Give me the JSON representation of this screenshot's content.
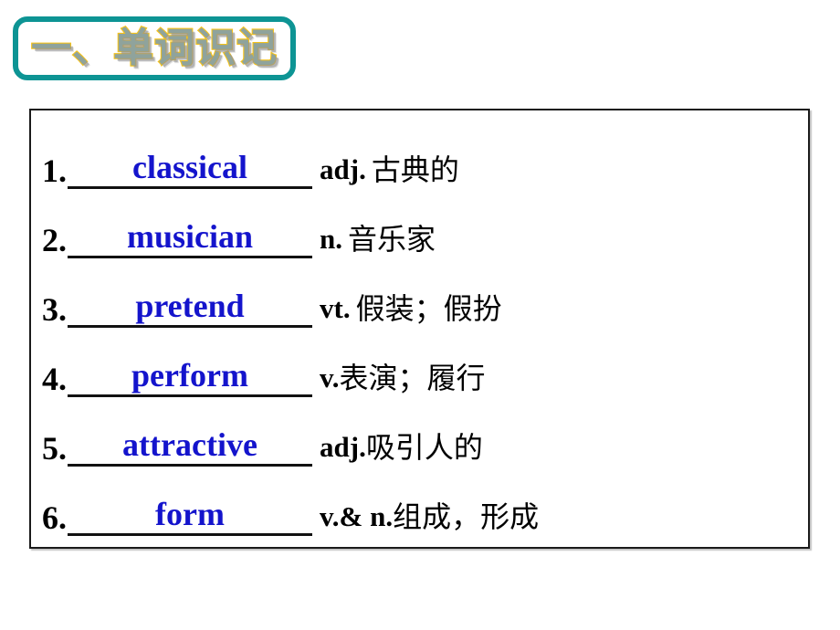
{
  "slide": {
    "title": "一、单词识记",
    "title_border_color": "#0d9494",
    "answer_color": "#1414cc",
    "text_color": "#000000"
  },
  "word_list": {
    "rows": [
      {
        "index": "1.",
        "answer": "classical",
        "pos": "adj.",
        "pos_gap": " ",
        "gloss": "古典的"
      },
      {
        "index": "2.",
        "answer": "musician",
        "pos": "n.",
        "pos_gap": " ",
        "gloss": "音乐家"
      },
      {
        "index": "3.",
        "answer": "pretend",
        "pos": "vt.",
        "pos_gap": " ",
        "gloss": "假装；假扮"
      },
      {
        "index": "4.",
        "answer": "perform",
        "pos": "v.",
        "pos_gap": "",
        "gloss": "表演；履行"
      },
      {
        "index": "5.",
        "answer": "attractive",
        "pos": "adj.",
        "pos_gap": "",
        "gloss": "吸引人的"
      },
      {
        "index": "6.",
        "answer": "form",
        "pos": "v.& n.",
        "pos_gap": "",
        "gloss": "组成，形成"
      }
    ]
  }
}
